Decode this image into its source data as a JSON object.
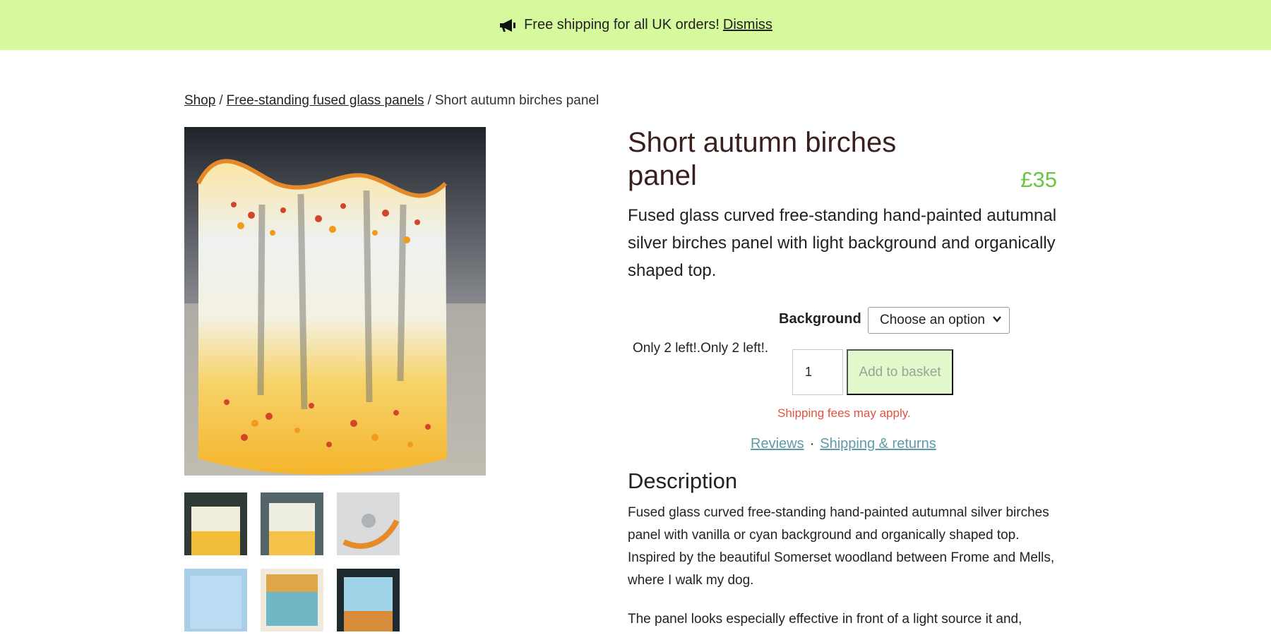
{
  "notice": {
    "text": "Free shipping for all UK orders!",
    "dismiss": "Dismiss"
  },
  "breadcrumb": {
    "shop": "Shop",
    "sep1": "/",
    "category": "Free-standing fused glass panels",
    "sep2": "/",
    "current": "Short autumn birches panel"
  },
  "product": {
    "title": "Short autumn birches panel",
    "price": "£35",
    "short_description": "Fused glass curved free-standing hand-painted autumnal silver birches panel with light background and organically shaped top.",
    "background_label": "Background",
    "background_selected": "Choose an option",
    "stock": "Only 2 left!.Only 2 left!.",
    "quantity": "1",
    "add_to_basket": "Add to basket",
    "shipping_note": "Shipping fees may apply."
  },
  "links": {
    "reviews": "Reviews",
    "separator": "·",
    "shipping": "Shipping & returns"
  },
  "description": {
    "heading": "Description",
    "p1": "Fused glass curved free-standing hand-painted autumnal silver birches panel with vanilla or cyan background and organically shaped top. Inspired by the beautiful Somerset woodland between Frome and Mells, where I walk my dog.",
    "p2": "The panel looks especially effective in front of a light source it and,"
  },
  "colors": {
    "notice_bg": "#d7f99d",
    "price": "#6cc442",
    "add_button_bg": "#e3f8cb",
    "shipping_note": "#e0533f",
    "link": "#5f9aa8"
  },
  "icons": {
    "notice": "megaphone-icon",
    "select": "chevron-down-icon"
  }
}
